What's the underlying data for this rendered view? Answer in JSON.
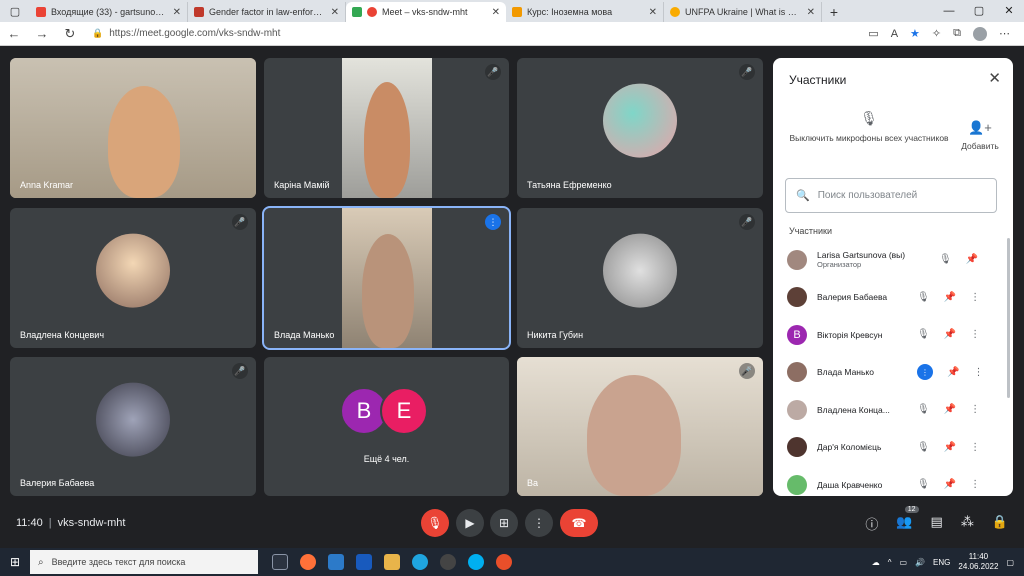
{
  "browser": {
    "tabs": [
      {
        "title": "Входящие (33) - gartsunova10@",
        "color": "#ea4335"
      },
      {
        "title": "Gender factor in law-enforceme",
        "color": "#c0392b"
      },
      {
        "title": "Meet – vks-sndw-mht",
        "color": "#34a853",
        "active": true
      },
      {
        "title": "Курс: Іноземна мова",
        "color": "#f29900"
      },
      {
        "title": "UNFPA Ukraine | What is gender",
        "color": "#f9ab00"
      }
    ],
    "url": "https://meet.google.com/vks-sndw-mht"
  },
  "tiles": [
    {
      "name": "Anna Kramar",
      "muted": false
    },
    {
      "name": "Каріна Мамій",
      "muted": true
    },
    {
      "name": "Татьяна Ефременко",
      "muted": true
    },
    {
      "name": "Владлена Концевич",
      "muted": true
    },
    {
      "name": "Влада Манько",
      "muted": false,
      "speaking": true
    },
    {
      "name": "Никита Губин",
      "muted": true
    },
    {
      "name": "Валерия Бабаева",
      "muted": true
    },
    {
      "name": "Ещё 4 чел.",
      "badges": [
        "В",
        "Е"
      ]
    },
    {
      "name": "Ва",
      "muted": true
    }
  ],
  "panel": {
    "title": "Участники",
    "mute_all": "Выключить микрофоны всех участников",
    "add": "Добавить",
    "search_placeholder": "Поиск пользователей",
    "section": "Участники",
    "people": [
      {
        "name": "Larisa Gartsunova (вы)",
        "sub": "Организатор",
        "color": "#a1887f"
      },
      {
        "name": "Валерия Бабаева",
        "color": "#5d4037"
      },
      {
        "name": "Вікторія Кревсун",
        "color": "#9c27b0",
        "letter": "В"
      },
      {
        "name": "Влада Манько",
        "color": "#8d6e63",
        "speaking": true
      },
      {
        "name": "Владлена Конца...",
        "color": "#bcaaa4"
      },
      {
        "name": "Дар'я Коломієць",
        "color": "#4e342e"
      },
      {
        "name": "Даша Кравченко",
        "color": "#66bb6a"
      }
    ]
  },
  "bottom": {
    "time": "11:40",
    "code": "vks-sndw-mht",
    "people_count": "12"
  },
  "taskbar": {
    "search": "Введите здесь текст для поиска",
    "time": "11:40",
    "date": "24.06.2022",
    "lang": "ENG"
  }
}
